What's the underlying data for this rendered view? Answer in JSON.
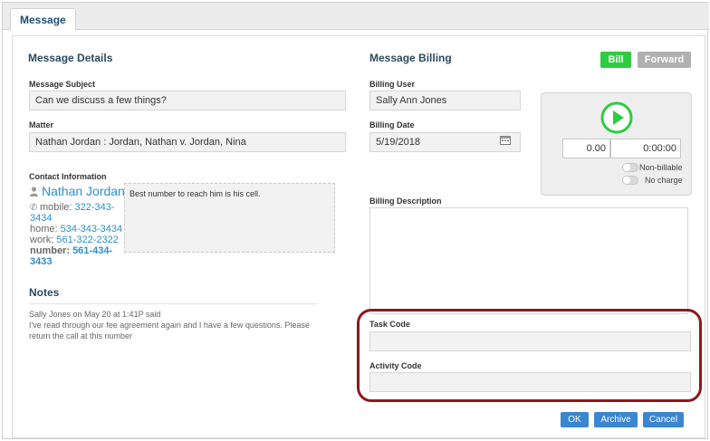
{
  "window": {
    "tab_label": "Message"
  },
  "message_details": {
    "title": "Message Details",
    "subject_label": "Message Subject",
    "subject_value": "Can we discuss a few things?",
    "matter_label": "Matter",
    "matter_value": "Nathan Jordan : Jordan, Nathan v. Jordan, Nina",
    "contact_label": "Contact Information",
    "contact_name": "Nathan Jordan",
    "phones": [
      {
        "label": "mobile: ",
        "number": "322-343-",
        "number2": "3434"
      },
      {
        "label": "home: ",
        "number": "534-343-3434"
      },
      {
        "label": "work: ",
        "number": "561-322-2322"
      },
      {
        "label": "number: ",
        "number": "561-434-",
        "number2": "3433"
      }
    ],
    "contact_note": "Best number to reach him is his cell."
  },
  "notes": {
    "title": "Notes",
    "entry_header": "Sally Jones on May 20 at 1:41P said",
    "entry_line1": "I've read through our fee agreement again and I have a few questions. Please",
    "entry_line2": "return the call at this number"
  },
  "billing": {
    "title": "Message Billing",
    "bill_button": "Bill",
    "forward_button": "Forward",
    "user_label": "Billing User",
    "user_value": "Sally Ann Jones",
    "date_label": "Billing Date",
    "date_value": "5/19/2018",
    "timer_amount": "0.00",
    "timer_time": "0:00:00",
    "non_billable_label": "Non-billable",
    "no_charge_label": "No charge",
    "description_label": "Billing Description",
    "task_code_label": "Task Code",
    "activity_code_label": "Activity Code"
  },
  "actions": {
    "ok": "OK",
    "archive": "Archive",
    "cancel": "Cancel"
  },
  "colors": {
    "accent_green": "#2ecc40",
    "button_blue": "#3a86d1",
    "highlight_red": "#8b1a1a"
  },
  "icons": [
    "person-icon",
    "phone-icon",
    "calendar-icon",
    "play-icon"
  ]
}
